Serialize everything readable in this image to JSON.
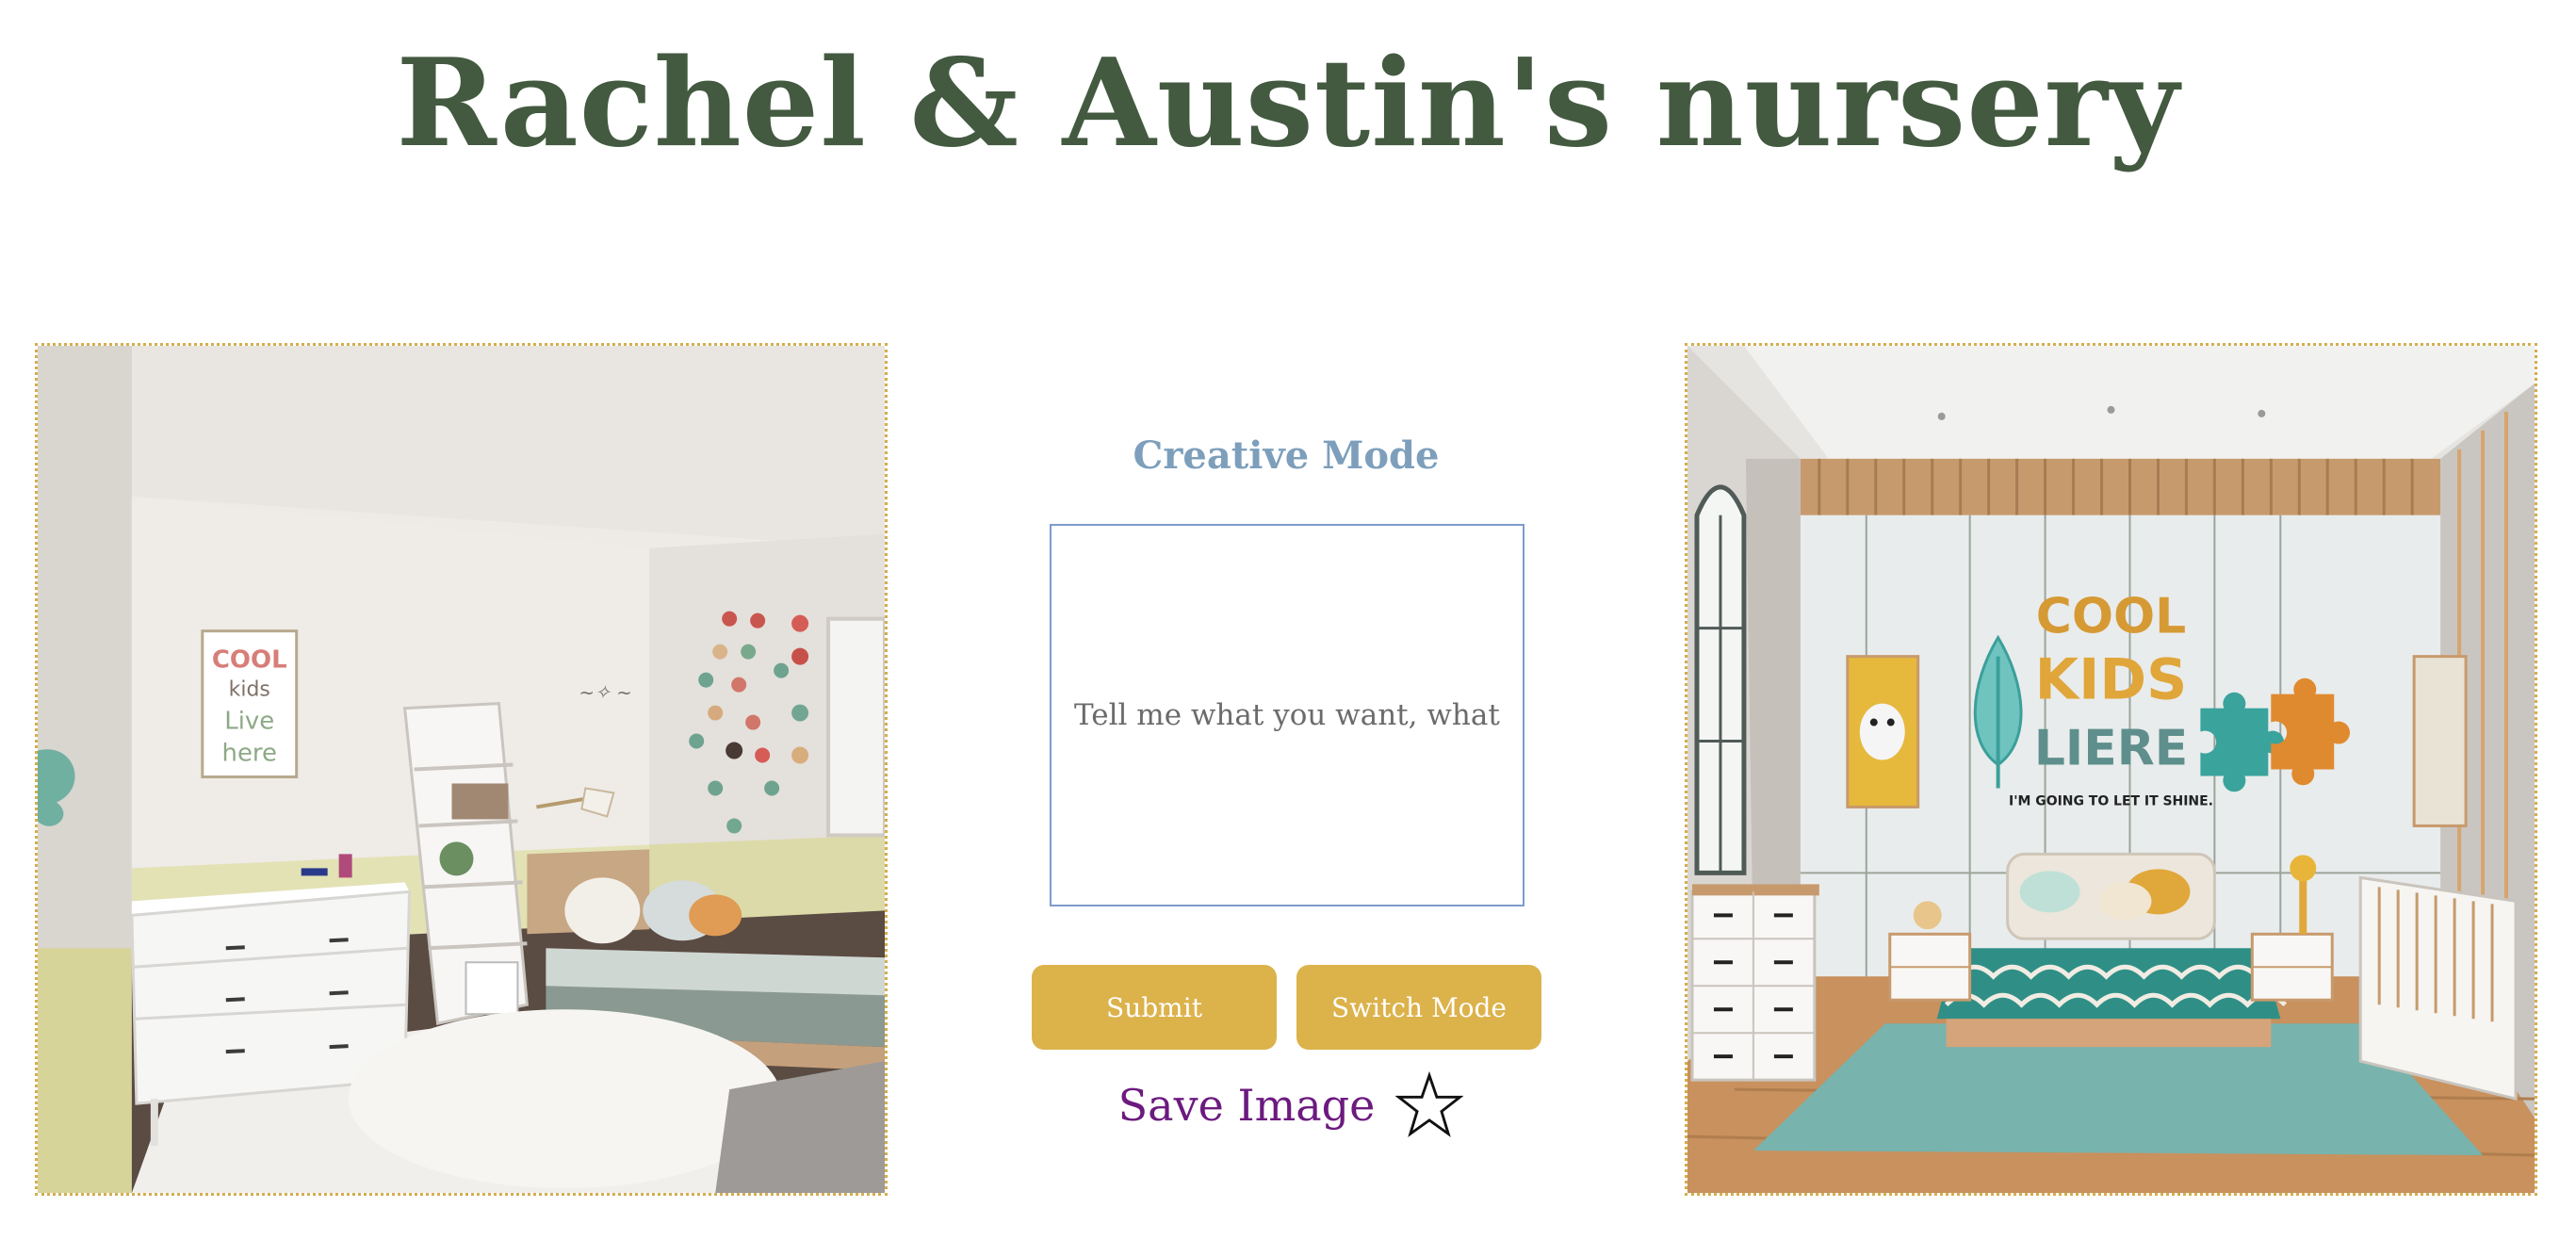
{
  "page": {
    "title": "Rachel & Austin's nursery"
  },
  "panel": {
    "mode_title": "Creative Mode",
    "prompt_placeholder": "Tell me what you want, what you really really want",
    "submit_label": "Submit",
    "switch_label": "Switch Mode",
    "save_label": "Save Image",
    "star_icon": "star-outline-icon"
  },
  "images": {
    "left": {
      "wall_art_line1": "COOL",
      "wall_art_line2": "kids",
      "wall_art_line3": "Live",
      "wall_art_line4": "here"
    },
    "right": {
      "sign_line1": "COOL",
      "sign_line2": "KIDS",
      "sign_line3": "LIERE",
      "sign_line4": "I'M GOING TO LET IT SHINE."
    }
  },
  "colors": {
    "title": "#435a40",
    "mode_title": "#7d9fbb",
    "button": "#dcb24b",
    "save_text": "#6c1a7f",
    "image_border": "#d4ad4e",
    "prompt_border": "#7e9ccc"
  }
}
